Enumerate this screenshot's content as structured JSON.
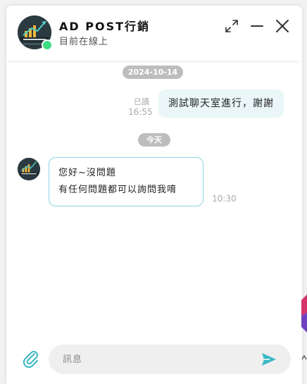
{
  "header": {
    "shop_name": "AD POST行銷",
    "status": "目前在線上",
    "icons": [
      "expand-icon",
      "minimize-icon",
      "close-icon"
    ]
  },
  "messages": {
    "date_1": "2024-10-14",
    "outgoing": {
      "text": "測試聊天室進行，謝謝",
      "read_label": "已讀",
      "time": "16:55"
    },
    "date_2": "今天",
    "incoming": {
      "line_1": "您好~沒問題",
      "line_2": "有任何問題都可以詢問我唷",
      "time": "10:30"
    }
  },
  "composer": {
    "placeholder": "訊息",
    "icons": [
      "paperclip-icon",
      "send-icon"
    ]
  },
  "colors": {
    "accent": "#3bb9c4",
    "online": "#3ddc84",
    "date_pill": "#bdbdbd",
    "outgoing_bubble": "#eaf6f7",
    "incoming_border": "#8fd3e6"
  }
}
